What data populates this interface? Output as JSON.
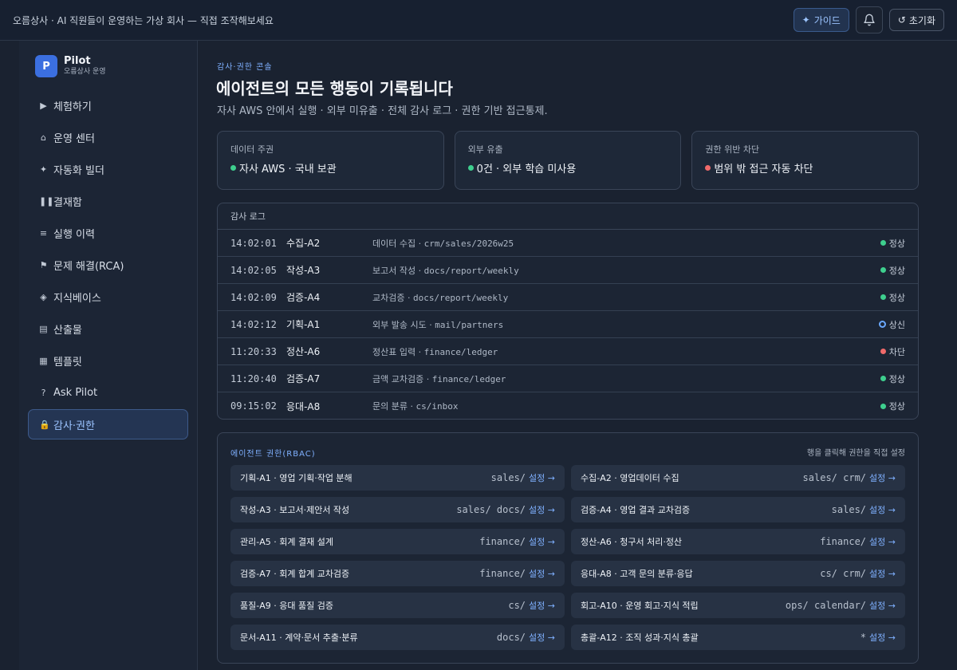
{
  "topbar": {
    "banner": "오름상사 · AI 직원들이 운영하는 가상 회사 — 직접 조작해보세요",
    "guide_label": "가이드",
    "reset_label": "초기화"
  },
  "sidebar": {
    "brand_initial": "P",
    "brand_name": "Pilot",
    "brand_sub": "오름상사 운영",
    "items": [
      {
        "label": "체험하기",
        "icon": "▶"
      },
      {
        "label": "운영 센터",
        "icon": "⌂"
      },
      {
        "label": "자동화 빌더",
        "icon": "✦"
      },
      {
        "label": "결재함",
        "icon": "❚❚"
      },
      {
        "label": "실행 이력",
        "icon": "≡"
      },
      {
        "label": "문제 해결(RCA)",
        "icon": "⚑"
      },
      {
        "label": "지식베이스",
        "icon": "◈"
      },
      {
        "label": "산출물",
        "icon": "▤"
      },
      {
        "label": "템플릿",
        "icon": "▦"
      },
      {
        "label": "Ask Pilot",
        "icon": "?"
      },
      {
        "label": "감사·권한",
        "icon": "🔒"
      }
    ]
  },
  "main": {
    "eyebrow": "감사·권한 콘솔",
    "title": "에이전트의 모든 행동이 기록됩니다",
    "subtitle": "자사 AWS 안에서 실행 · 외부 미유출 · 전체 감사 로그 · 권한 기반 접근통제.",
    "cards": [
      {
        "label": "데이터 주권",
        "value": "자사 AWS · 국내 보관",
        "color": "#3ecf8e"
      },
      {
        "label": "외부 유출",
        "value": "0건 · 외부 학습 미사용",
        "color": "#3ecf8e"
      },
      {
        "label": "권한 위반 차단",
        "value": "범위 밖 접근 자동 차단",
        "color": "#f06a6a"
      }
    ]
  },
  "audit": {
    "title": "감사 로그",
    "rows": [
      {
        "time": "14:02:01",
        "agent": "수집-A2",
        "action": "데이터 수집 · ",
        "path": "crm/sales/2026w25",
        "status": "정상",
        "kind": "ok"
      },
      {
        "time": "14:02:05",
        "agent": "작성-A3",
        "action": "보고서 작성 · ",
        "path": "docs/report/weekly",
        "status": "정상",
        "kind": "ok"
      },
      {
        "time": "14:02:09",
        "agent": "검증-A4",
        "action": "교차검증 · ",
        "path": "docs/report/weekly",
        "status": "정상",
        "kind": "ok"
      },
      {
        "time": "14:02:12",
        "agent": "기획-A1",
        "action": "외부 발송 시도 · ",
        "path": "mail/partners",
        "status": "상신",
        "kind": "pending"
      },
      {
        "time": "11:20:33",
        "agent": "정산-A6",
        "action": "정산표 입력 · ",
        "path": "finance/ledger",
        "status": "차단",
        "kind": "blocked"
      },
      {
        "time": "11:20:40",
        "agent": "검증-A7",
        "action": "금액 교차검증 · ",
        "path": "finance/ledger",
        "status": "정상",
        "kind": "ok"
      },
      {
        "time": "09:15:02",
        "agent": "응대-A8",
        "action": "문의 분류 · ",
        "path": "cs/inbox",
        "status": "정상",
        "kind": "ok"
      }
    ]
  },
  "rbac": {
    "title": "에이전트 권한(RBAC)",
    "hint": "행을 클릭해 권한을 직접 설정",
    "set_label": "설정 →",
    "items": [
      {
        "name": "기획-A1 · 영업 기획·작업 분해",
        "scope": "sales/"
      },
      {
        "name": "수집-A2 · 영업데이터 수집",
        "scope": "sales/ crm/"
      },
      {
        "name": "작성-A3 · 보고서·제안서 작성",
        "scope": "sales/ docs/"
      },
      {
        "name": "검증-A4 · 영업 결과 교차검증",
        "scope": "sales/"
      },
      {
        "name": "관리-A5 · 회계 결재 설계",
        "scope": "finance/"
      },
      {
        "name": "정산-A6 · 청구서 처리·정산",
        "scope": "finance/"
      },
      {
        "name": "검증-A7 · 회계 합계 교차검증",
        "scope": "finance/"
      },
      {
        "name": "응대-A8 · 고객 문의 분류·응답",
        "scope": "cs/ crm/"
      },
      {
        "name": "품질-A9 · 응대 품질 검증",
        "scope": "cs/"
      },
      {
        "name": "회고-A10 · 운영 회고·지식 적립",
        "scope": "ops/ calendar/"
      },
      {
        "name": "문서-A11 · 계약·문서 추출·분류",
        "scope": "docs/"
      },
      {
        "name": "총괄-A12 · 조직 성과·지식 총괄",
        "scope": "*"
      }
    ]
  },
  "colors": {
    "ok": "#3ecf8e",
    "blocked": "#f06a6a",
    "pending": "#6aa8ff",
    "accent": "#7fb0ff"
  }
}
